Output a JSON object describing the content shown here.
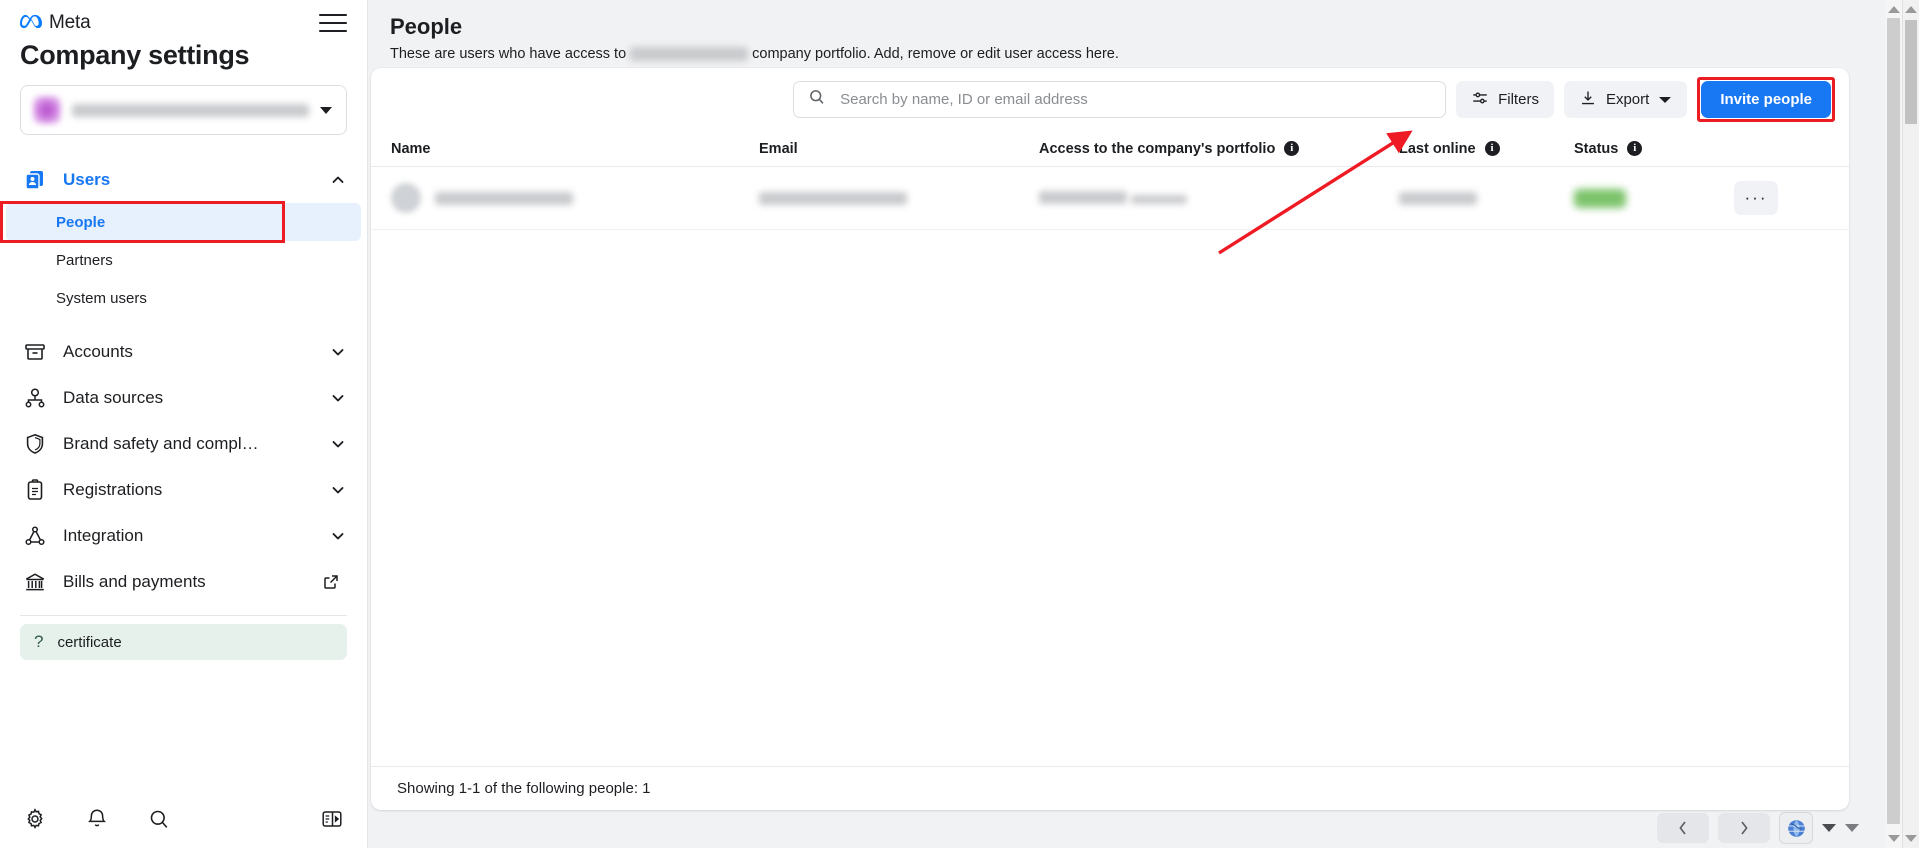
{
  "brand": {
    "logo_text": "Meta",
    "logo_icon": "meta-infinity-icon",
    "menu_icon": "hamburger-menu-icon"
  },
  "sidebar": {
    "title": "Company settings",
    "portfolio_selector": {
      "name_redacted": true,
      "caret_icon": "chevron-down-icon"
    },
    "groups": [
      {
        "label": "Users",
        "icon": "users-card-icon",
        "expanded": true,
        "active": true,
        "chevron": "chevron-up-icon",
        "children": [
          {
            "label": "People",
            "selected": true,
            "highlighted": true
          },
          {
            "label": "Partners",
            "selected": false
          },
          {
            "label": "System users",
            "selected": false
          }
        ]
      },
      {
        "label": "Accounts",
        "icon": "archive-box-icon",
        "expanded": false,
        "chevron": "chevron-down-icon",
        "children": []
      },
      {
        "label": "Data sources",
        "icon": "data-sources-icon",
        "expanded": false,
        "chevron": "chevron-down-icon",
        "children": []
      },
      {
        "label": "Brand safety and compl…",
        "icon": "shield-icon",
        "expanded": false,
        "chevron": "chevron-down-icon",
        "children": []
      },
      {
        "label": "Registrations",
        "icon": "clipboard-icon",
        "expanded": false,
        "chevron": "chevron-down-icon",
        "children": []
      },
      {
        "label": "Integration",
        "icon": "integration-nodes-icon",
        "expanded": false,
        "chevron": "chevron-down-icon",
        "children": []
      },
      {
        "label": "Bills and payments",
        "icon": "bank-icon",
        "external": true,
        "external_icon": "external-link-icon",
        "children": []
      }
    ],
    "certificate_item": {
      "label": "certificate",
      "icon": "question-mark-icon"
    },
    "bottom_icons": [
      {
        "name": "gear-icon"
      },
      {
        "name": "bell-icon"
      },
      {
        "name": "search-icon"
      },
      {
        "name": "panel-collapse-icon"
      }
    ]
  },
  "main": {
    "title": "People",
    "subtitle_before": "These are users who have access to",
    "subtitle_after": "company portfolio. Add, remove or edit user access here.",
    "toolbar": {
      "search_placeholder": "Search by name, ID or email address",
      "search_value": "",
      "search_icon": "search-icon",
      "filters_label": "Filters",
      "filters_icon": "sliders-icon",
      "export_label": "Export",
      "export_icon": "download-icon",
      "export_caret_icon": "chevron-down-icon",
      "invite_label": "Invite people"
    },
    "table": {
      "columns": [
        {
          "label": "Name",
          "info": false
        },
        {
          "label": "Email",
          "info": false
        },
        {
          "label": "Access to the company's portfolio",
          "info": true,
          "info_icon": "info-icon"
        },
        {
          "label": "Last online",
          "info": true,
          "info_icon": "info-icon"
        },
        {
          "label": "Status",
          "info": true,
          "info_icon": "info-icon"
        }
      ],
      "rows": [
        {
          "avatar_redacted": true,
          "name_redacted": true,
          "email_redacted": true,
          "access_redacted": true,
          "access_sub_redacted": true,
          "last_online_redacted": true,
          "status_redacted": true,
          "status_color": "#7cc36a",
          "menu_label": "···",
          "menu_icon": "kebab-menu-icon"
        }
      ],
      "footer": "Showing 1-1 of the following people: 1"
    }
  },
  "pagination": {
    "prev_icon": "chevron-left-icon",
    "next_icon": "chevron-right-icon",
    "globe_icon": "globe-icon",
    "dropdown_icon": "triangle-down-icon"
  },
  "annotations": {
    "highlight_color": "#ec1c24",
    "arrow_color": "#ee1b24",
    "boxes": [
      "people-sidebar-item",
      "invite-people-button"
    ],
    "arrow_points_to": "status-column-header"
  },
  "colors": {
    "accent_blue": "#1877f2",
    "sidebar_selected_bg": "#e7f0fd",
    "page_bg": "#f1f2f4",
    "certificate_bg": "#e7f1ec"
  }
}
